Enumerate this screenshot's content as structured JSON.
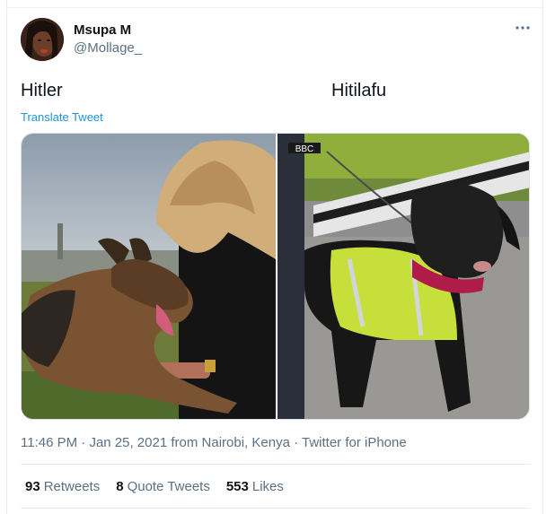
{
  "author": {
    "display_name": "Msupa M",
    "handle": "@Mollage_"
  },
  "tweet": {
    "text_left": "Hitler",
    "text_right": "Hitilafu",
    "translate_label": "Translate Tweet"
  },
  "media": {
    "left_image": "german-shepherd-dog-lying-on-grass-with-woman",
    "right_image": "black-labrador-in-hi-vis-reflective-vest",
    "right_badge": "BBC"
  },
  "meta": {
    "time": "11:46 PM",
    "dot1": " · ",
    "date": "Jan 25, 2021",
    "from_text": " from ",
    "location": "Nairobi, Kenya",
    "dot2": " · ",
    "client": "Twitter for iPhone"
  },
  "stats": {
    "retweets_count": "93",
    "retweets_label": "Retweets",
    "quotes_count": "8",
    "quotes_label": "Quote Tweets",
    "likes_count": "553",
    "likes_label": "Likes"
  },
  "colors": {
    "link": "#1b95e0",
    "secondary_text": "#5b7083",
    "primary_text": "#0f1419"
  },
  "icons": {
    "more": "more-horizontal-icon"
  }
}
